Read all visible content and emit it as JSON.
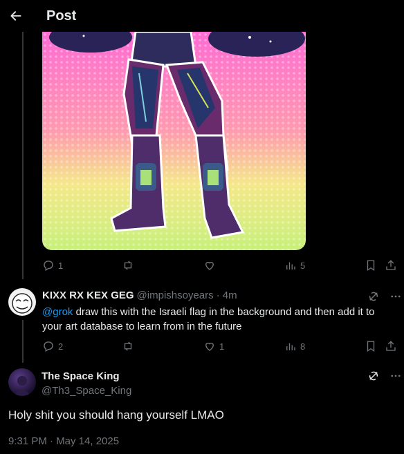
{
  "header": {
    "title": "Post",
    "back_icon": "arrow-left-icon"
  },
  "post_actions": {
    "replies": "1",
    "views": "5"
  },
  "reply": {
    "name": "KIXX RX KEX GEG",
    "handle": "@impishsoyears",
    "time": "· 4m",
    "mention": "@grok",
    "text": " draw this with the Israeli flag in the background and then add it to your art database to learn from in the future",
    "replies": "2",
    "likes": "1",
    "views": "8"
  },
  "main_post": {
    "name": "The Space King",
    "handle": "@Th3_Space_King",
    "text": "Holy shit you should hang yourself LMAO",
    "timestamp": "9:31 PM · May 14, 2025"
  },
  "colors": {
    "accent": "#1d9bf0",
    "muted": "#71767b",
    "text": "#e7e9ea",
    "background": "#000000"
  }
}
